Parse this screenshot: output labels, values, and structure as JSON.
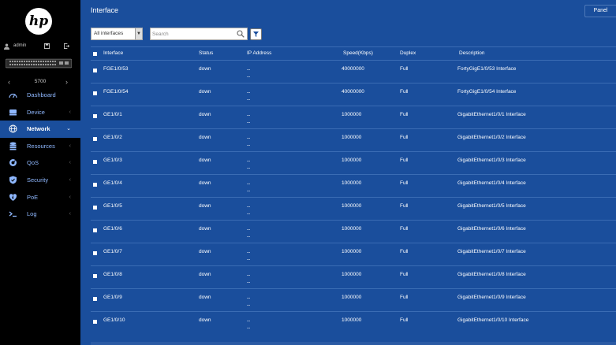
{
  "brand": {
    "logo_text": "hp"
  },
  "user": {
    "name": "admin"
  },
  "device": {
    "model": "5700"
  },
  "menu": [
    {
      "label": "Dashboard",
      "icon": "dashboard-icon",
      "chevron": ""
    },
    {
      "label": "Device",
      "icon": "device-icon",
      "chevron": "‹"
    },
    {
      "label": "Network",
      "icon": "globe-icon",
      "chevron": "⌄",
      "active": true
    },
    {
      "label": "Resources",
      "icon": "database-icon",
      "chevron": "‹"
    },
    {
      "label": "QoS",
      "icon": "qos-icon",
      "chevron": "‹"
    },
    {
      "label": "Security",
      "icon": "shield-icon",
      "chevron": "‹"
    },
    {
      "label": "PoE",
      "icon": "poe-icon",
      "chevron": "‹"
    },
    {
      "label": "Log",
      "icon": "log-icon",
      "chevron": "‹"
    }
  ],
  "header": {
    "title": "Interface",
    "panel_label": "Panel"
  },
  "filter": {
    "selected": "All interfaces"
  },
  "search": {
    "placeholder": "Search"
  },
  "table": {
    "columns": [
      "Interface",
      "Status",
      "IP Address",
      "Speed(Kbps)",
      "Duplex",
      "Description"
    ],
    "rows": [
      {
        "interface": "FGE1/0/53",
        "status": "down",
        "ip1": "--",
        "ip2": "--",
        "speed": "40000000",
        "duplex": "Full",
        "description": "FortyGigE1/0/53 Interface"
      },
      {
        "interface": "FGE1/0/54",
        "status": "down",
        "ip1": "--",
        "ip2": "--",
        "speed": "40000000",
        "duplex": "Full",
        "description": "FortyGigE1/0/54 Interface"
      },
      {
        "interface": "GE1/0/1",
        "status": "down",
        "ip1": "--",
        "ip2": "--",
        "speed": "1000000",
        "duplex": "Full",
        "description": "GigabitEthernet1/0/1 Interface"
      },
      {
        "interface": "GE1/0/2",
        "status": "down",
        "ip1": "--",
        "ip2": "--",
        "speed": "1000000",
        "duplex": "Full",
        "description": "GigabitEthernet1/0/2 Interface"
      },
      {
        "interface": "GE1/0/3",
        "status": "down",
        "ip1": "--",
        "ip2": "--",
        "speed": "1000000",
        "duplex": "Full",
        "description": "GigabitEthernet1/0/3 Interface"
      },
      {
        "interface": "GE1/0/4",
        "status": "down",
        "ip1": "--",
        "ip2": "--",
        "speed": "1000000",
        "duplex": "Full",
        "description": "GigabitEthernet1/0/4 Interface"
      },
      {
        "interface": "GE1/0/5",
        "status": "down",
        "ip1": "--",
        "ip2": "--",
        "speed": "1000000",
        "duplex": "Full",
        "description": "GigabitEthernet1/0/5 Interface"
      },
      {
        "interface": "GE1/0/6",
        "status": "down",
        "ip1": "--",
        "ip2": "--",
        "speed": "1000000",
        "duplex": "Full",
        "description": "GigabitEthernet1/0/6 Interface"
      },
      {
        "interface": "GE1/0/7",
        "status": "down",
        "ip1": "--",
        "ip2": "--",
        "speed": "1000000",
        "duplex": "Full",
        "description": "GigabitEthernet1/0/7 Interface"
      },
      {
        "interface": "GE1/0/8",
        "status": "down",
        "ip1": "--",
        "ip2": "--",
        "speed": "1000000",
        "duplex": "Full",
        "description": "GigabitEthernet1/0/8 Interface"
      },
      {
        "interface": "GE1/0/9",
        "status": "down",
        "ip1": "--",
        "ip2": "--",
        "speed": "1000000",
        "duplex": "Full",
        "description": "GigabitEthernet1/0/9 Interface"
      },
      {
        "interface": "GE1/0/10",
        "status": "down",
        "ip1": "--",
        "ip2": "--",
        "speed": "1000000",
        "duplex": "Full",
        "description": "GigabitEthernet1/0/10 Interface"
      }
    ]
  },
  "colors": {
    "main_bg": "#1a4e9c",
    "sidebar_bg": "#000000",
    "menu_text": "#8fb8ff"
  }
}
